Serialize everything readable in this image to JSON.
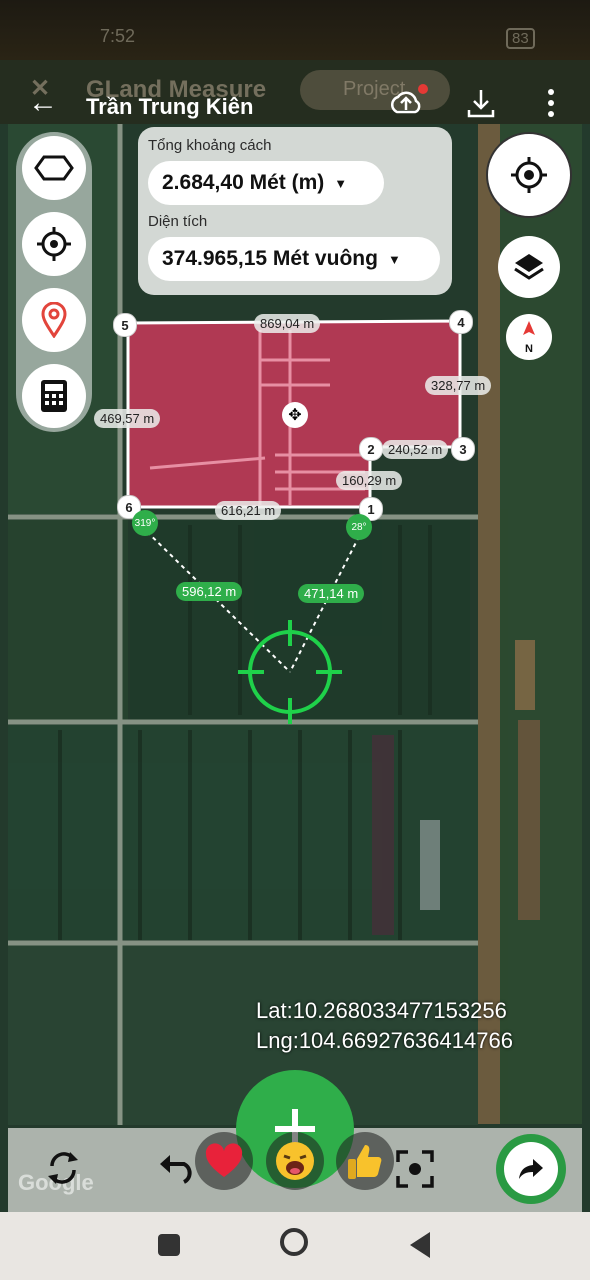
{
  "status_bar": {
    "time": "7:52",
    "battery": "83"
  },
  "app_behind": {
    "title": "GLand Measure",
    "project_label": "Project"
  },
  "chat_header": {
    "contact_name": "Trần Trung Kiên"
  },
  "measure_panel": {
    "distance_label": "Tổng khoảng cách",
    "distance_value": "2.684,40 Mét (m)",
    "area_label": "Diện tích",
    "area_value": "374.965,15 Mét vuông"
  },
  "map": {
    "vertices": [
      "1",
      "2",
      "3",
      "4",
      "5",
      "6"
    ],
    "edge_labels": {
      "top": "869,04 m",
      "right_upper": "328,77 m",
      "step_horizontal": "240,52 m",
      "step_vertical": "160,29 m",
      "bottom": "616,21 m",
      "left": "469,57 m"
    },
    "guide_labels": {
      "left": "596,12 m",
      "right": "471,14 m"
    },
    "angle_badges": {
      "left": "319°",
      "right": "28°"
    },
    "compass": "N",
    "colors": {
      "polygon_fill": "#d93a5f",
      "guide_green": "#2fae4a",
      "crosshair": "#1fd14a"
    }
  },
  "coords": {
    "lat": "Lat:10.268033477153256",
    "lng": "Lng:104.66927636414766"
  },
  "watermark": "Google",
  "reactions": [
    "heart",
    "laughing",
    "thumbs-up"
  ],
  "icons": [
    "back-arrow-icon",
    "upload-cloud-icon",
    "download-icon",
    "more-vert-icon",
    "polygon-icon",
    "crosshair-icon",
    "location-pin-icon",
    "calculator-icon",
    "my-location-icon",
    "layers-icon",
    "compass-icon",
    "refresh-icon",
    "undo-icon",
    "scan-icon",
    "share-icon",
    "plus-icon"
  ]
}
